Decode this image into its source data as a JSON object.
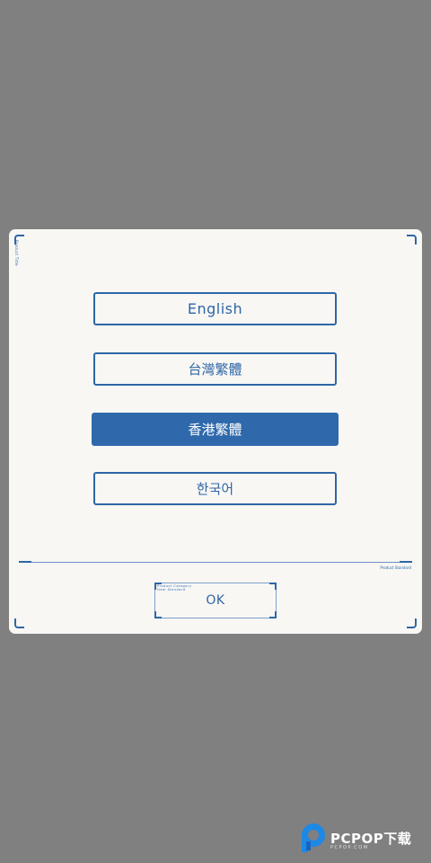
{
  "dialog": {
    "side_label": "Product Title",
    "languages": [
      {
        "label": "English",
        "selected": false
      },
      {
        "label": "台灣繁體",
        "selected": false
      },
      {
        "label": "香港繁體",
        "selected": true
      },
      {
        "label": "한국어",
        "selected": false
      }
    ],
    "divider_note": "Product Standard",
    "ok": {
      "label": "OK",
      "note_line1": "Product Category",
      "note_line2": "Item Standard"
    }
  },
  "watermark": {
    "brand": "PCPOP下载",
    "sub": "PCPOP.COM"
  },
  "colors": {
    "overlay": "#808080",
    "dialog_bg": "#f8f7f4",
    "accent": "#2f66a6",
    "selected_bg": "#2f69ab"
  }
}
